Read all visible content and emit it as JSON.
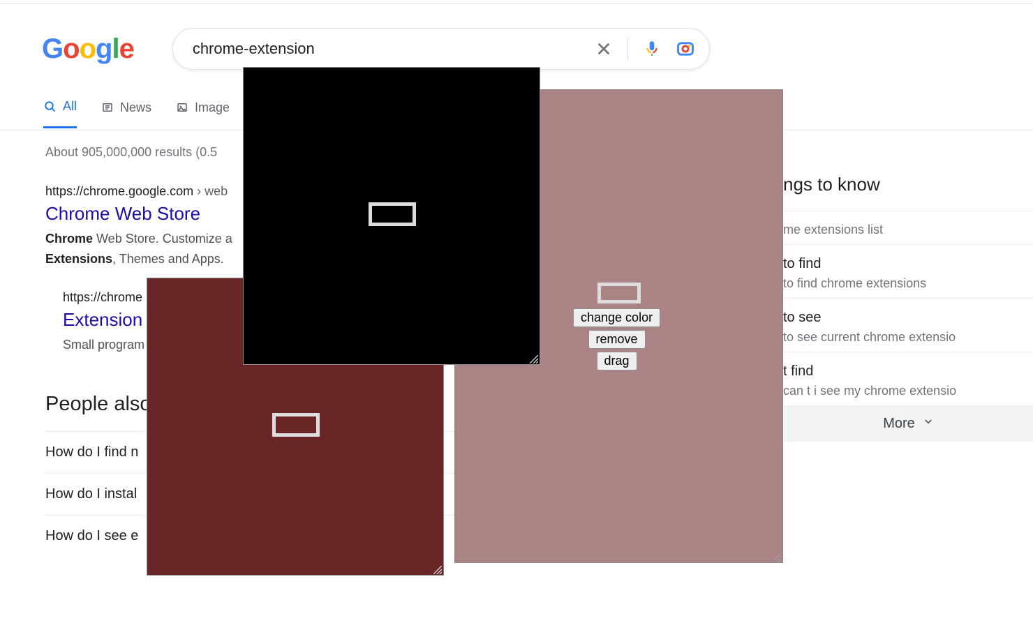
{
  "search": {
    "query": "chrome-extension"
  },
  "tabs": {
    "all": "All",
    "news": "News",
    "images": "Image"
  },
  "stats": "About 905,000,000 results (0.5",
  "result1": {
    "domain": "https://chrome.google.com",
    "path": " › web",
    "title": "Chrome Web Store",
    "snippet_bold1": "Chrome",
    "snippet_mid": " Web Store. Customize a",
    "snippet_bold2": "Extensions",
    "snippet_end": ", Themes and Apps. "
  },
  "result1_sub": {
    "domain": "https://chrome",
    "title": "Extension",
    "snippet": "Small program"
  },
  "paa": {
    "heading": "People also",
    "q1": "How do I find n",
    "q2": "How do I instal",
    "q3": "How do I see e"
  },
  "sidebar": {
    "heading": "ngs to know",
    "b1_title": "me extensions list",
    "b2_title": "to find",
    "b2_sub": "to find chrome extensions",
    "b3_title": "to see",
    "b3_sub": "to see current chrome extensio",
    "b4_title": "t find",
    "b4_sub": "can t i see my chrome extensio",
    "more": "More"
  },
  "overlay": {
    "change_color": "change color",
    "remove": "remove",
    "drag": "drag"
  }
}
